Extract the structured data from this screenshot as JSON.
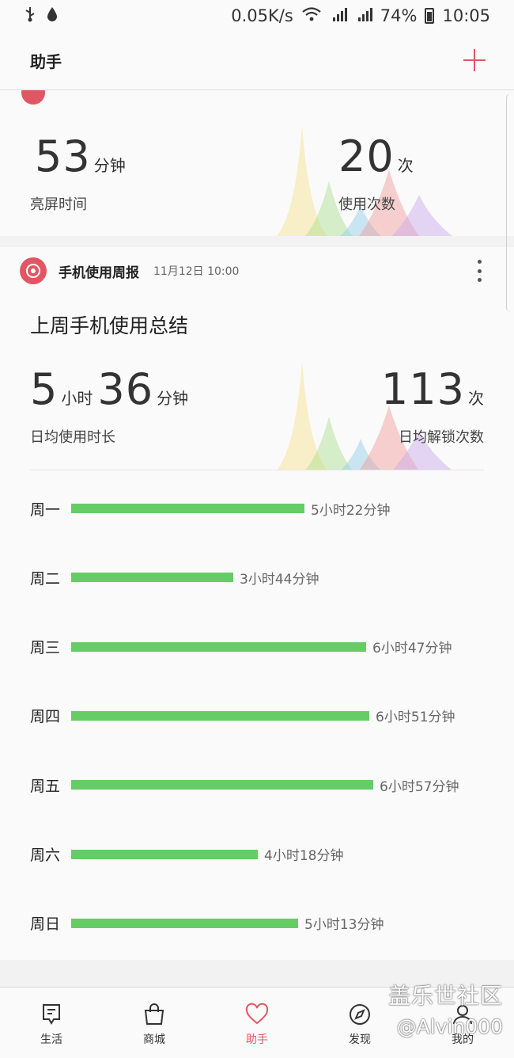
{
  "status_bar": {
    "speed": "0.05K/s",
    "battery": "74%",
    "time": "10:05",
    "left_icons": [
      "usb-icon",
      "drop-icon"
    ],
    "right_icons": [
      "wifi-icon",
      "signal-3g-icon",
      "signal-4g-icon",
      "battery-icon"
    ]
  },
  "header": {
    "title": "助手"
  },
  "today_card": {
    "screen_time": {
      "value": "53",
      "unit": "分钟",
      "label": "亮屏时间"
    },
    "uses": {
      "value": "20",
      "unit": "次",
      "label": "使用次数"
    }
  },
  "report_card": {
    "title": "手机使用周报",
    "time": "11月12日 10:00",
    "summary_title": "上周手机使用总结",
    "avg": {
      "hours": "5",
      "hours_unit": "小时",
      "minutes": "36",
      "minutes_unit": "分钟",
      "label": "日均使用时长"
    },
    "unlocks": {
      "value": "113",
      "unit": "次",
      "label": "日均解锁次数"
    },
    "bar_color": "#66cc66",
    "days": [
      {
        "label": "周一",
        "value_text": "5小时22分钟",
        "minutes": 322
      },
      {
        "label": "周二",
        "value_text": "3小时44分钟",
        "minutes": 224
      },
      {
        "label": "周三",
        "value_text": "6小时47分钟",
        "minutes": 407
      },
      {
        "label": "周四",
        "value_text": "6小时51分钟",
        "minutes": 411
      },
      {
        "label": "周五",
        "value_text": "6小时57分钟",
        "minutes": 417
      },
      {
        "label": "周六",
        "value_text": "4小时18分钟",
        "minutes": 258
      },
      {
        "label": "周日",
        "value_text": "5小时13分钟",
        "minutes": 313
      }
    ]
  },
  "nav": [
    {
      "label": "生活",
      "icon": "life-icon",
      "active": false
    },
    {
      "label": "商城",
      "icon": "shopping-bag-icon",
      "active": false
    },
    {
      "label": "助手",
      "icon": "heart-icon",
      "active": true
    },
    {
      "label": "发现",
      "icon": "compass-icon",
      "active": false
    },
    {
      "label": "我的",
      "icon": "profile-icon",
      "active": false
    }
  ],
  "watermark": {
    "line1": "盖乐世社区",
    "line2": "@Alvin000"
  },
  "colors": {
    "accent": "#e25563",
    "bar": "#66cc66"
  }
}
